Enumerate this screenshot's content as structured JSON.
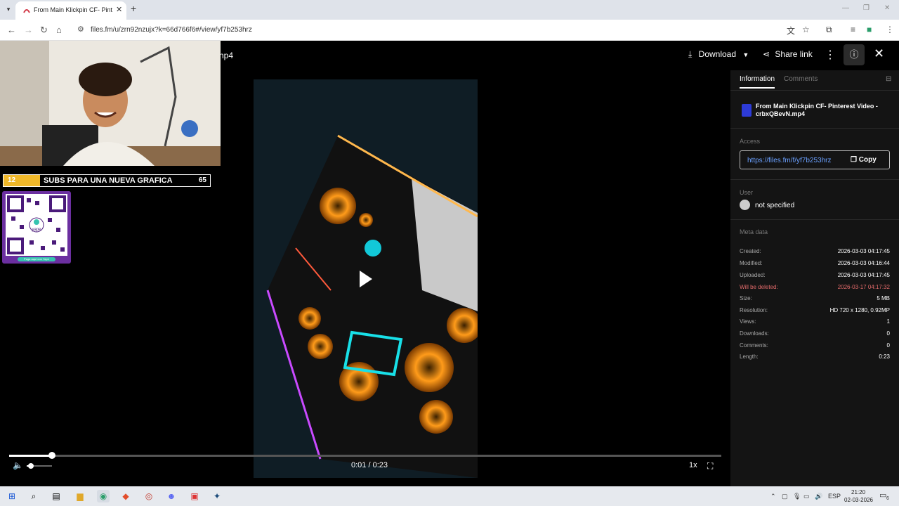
{
  "browser": {
    "tab_title": "From Main Klickpin CF- Pinterest",
    "tab_close": "✕",
    "new_tab": "+",
    "url": "files.fm/u/zrn92nzujx?k=66d766f6#/view/yf7b253hrz"
  },
  "viewer": {
    "filename_fragment": "np4",
    "download_label": "Download",
    "share_label": "Share link",
    "time": "0:01 / 0:23",
    "speed": "1x",
    "progress": 0.06,
    "volume": 0.18
  },
  "panel": {
    "tab_information": "Information",
    "tab_comments": "Comments",
    "file_name": "From Main Klickpin CF- Pinterest Video - crbxQBevN.mp4",
    "access_label": "Access",
    "link": "https://files.fm/f/yf7b253hrz",
    "copy_label": "Copy",
    "user_label": "User",
    "user_value": "not specified",
    "meta_label": "Meta data",
    "meta": [
      {
        "k": "Created:",
        "v": "2026-03-03 04:17:45"
      },
      {
        "k": "Modified:",
        "v": "2026-03-03 04:16:44"
      },
      {
        "k": "Uploaded:",
        "v": "2026-03-03 04:17:45"
      },
      {
        "k": "Will be deleted:",
        "v": "2026-03-17 04:17:32"
      },
      {
        "k": "Size:",
        "v": "5 MB"
      },
      {
        "k": "Resolution:",
        "v": "HD 720 x 1280, 0.92MP"
      },
      {
        "k": "Views:",
        "v": "1"
      },
      {
        "k": "Downloads:",
        "v": "0"
      },
      {
        "k": "Comments:",
        "v": "0"
      },
      {
        "k": "Length:",
        "v": "0:23"
      }
    ]
  },
  "overlay": {
    "subs_current": "12",
    "subs_text": "SUBS PARA UNA NUEVA GRAFICA",
    "subs_goal": "65",
    "qr_center": "yape",
    "qr_caption": "Paga aquí con Yape"
  },
  "taskbar": {
    "time": "21:20",
    "date": "02-03-2026",
    "lang": "ESP",
    "notifications": "6"
  },
  "colors": {
    "accent_link": "#6aa0ff",
    "delete_warning": "#e26a6a",
    "subs_yellow": "#f0b829",
    "qr_purple": "#6b2fa0"
  }
}
